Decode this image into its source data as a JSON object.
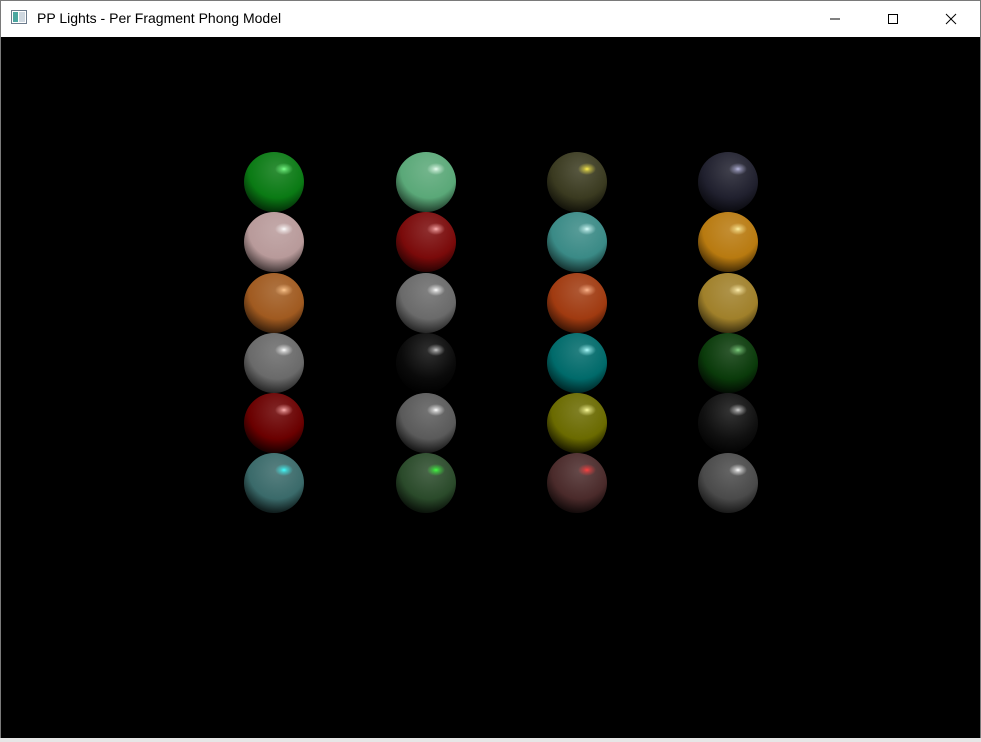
{
  "window": {
    "title": "PP Lights - Per Fragment Phong Model"
  },
  "icons": {
    "app": "app-window-icon",
    "minimize": "minimize-icon",
    "maximize": "maximize-icon",
    "close": "close-icon"
  },
  "scene": {
    "background": "#000000",
    "columns": 4,
    "rows": 6,
    "spheres": [
      {
        "row": 0,
        "col": 0,
        "base": "#0a7a14",
        "spec": "#7cff8a",
        "lit": 0.95
      },
      {
        "row": 0,
        "col": 1,
        "base": "#5aa878",
        "spec": "#e8fff0",
        "lit": 0.95
      },
      {
        "row": 0,
        "col": 2,
        "base": "#3a3a20",
        "spec": "#fff04a",
        "lit": 0.85
      },
      {
        "row": 0,
        "col": 3,
        "base": "#20202e",
        "spec": "#b8b8e0",
        "lit": 0.85
      },
      {
        "row": 1,
        "col": 0,
        "base": "#b89a9a",
        "spec": "#ffffff",
        "lit": 0.95
      },
      {
        "row": 1,
        "col": 1,
        "base": "#7a0a0a",
        "spec": "#ffb0b0",
        "lit": 0.9
      },
      {
        "row": 1,
        "col": 2,
        "base": "#3a8a86",
        "spec": "#d8fffc",
        "lit": 0.95
      },
      {
        "row": 1,
        "col": 3,
        "base": "#b87a10",
        "spec": "#fff0a0",
        "lit": 0.95
      },
      {
        "row": 2,
        "col": 0,
        "base": "#a05a20",
        "spec": "#ffc890",
        "lit": 0.95
      },
      {
        "row": 2,
        "col": 1,
        "base": "#6a6a6a",
        "spec": "#ffffff",
        "lit": 0.95
      },
      {
        "row": 2,
        "col": 2,
        "base": "#a03a10",
        "spec": "#ffb890",
        "lit": 0.95
      },
      {
        "row": 2,
        "col": 3,
        "base": "#a0802a",
        "spec": "#fff0b0",
        "lit": 0.95
      },
      {
        "row": 3,
        "col": 0,
        "base": "#6a6a6a",
        "spec": "#ffffff",
        "lit": 0.95
      },
      {
        "row": 3,
        "col": 1,
        "base": "#0a0a0a",
        "spec": "#c8c8c8",
        "lit": 0.5
      },
      {
        "row": 3,
        "col": 2,
        "base": "#006a6a",
        "spec": "#b0ffff",
        "lit": 0.95
      },
      {
        "row": 3,
        "col": 3,
        "base": "#0a3a0a",
        "spec": "#80d080",
        "lit": 0.6
      },
      {
        "row": 4,
        "col": 0,
        "base": "#6a0000",
        "spec": "#ffb0b0",
        "lit": 0.7
      },
      {
        "row": 4,
        "col": 1,
        "base": "#5a5a5a",
        "spec": "#ffffff",
        "lit": 0.7
      },
      {
        "row": 4,
        "col": 2,
        "base": "#6a6a00",
        "spec": "#ffffa0",
        "lit": 0.7
      },
      {
        "row": 4,
        "col": 3,
        "base": "#101010",
        "spec": "#d0d0d0",
        "lit": 0.5
      },
      {
        "row": 5,
        "col": 0,
        "base": "#3a6a6a",
        "spec": "#40ffff",
        "lit": 0.7
      },
      {
        "row": 5,
        "col": 1,
        "base": "#2a4a2a",
        "spec": "#40ff40",
        "lit": 0.7
      },
      {
        "row": 5,
        "col": 2,
        "base": "#4a2a2a",
        "spec": "#ff4040",
        "lit": 0.7
      },
      {
        "row": 5,
        "col": 3,
        "base": "#4a4a4a",
        "spec": "#ffffff",
        "lit": 0.9
      }
    ]
  }
}
